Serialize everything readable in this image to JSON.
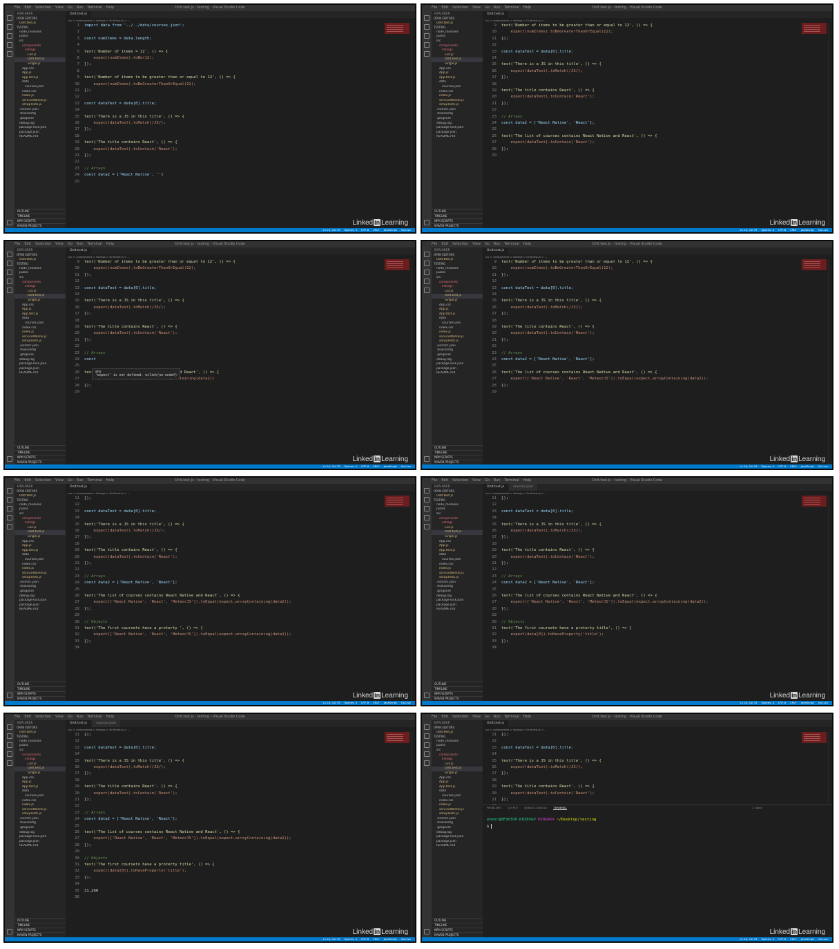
{
  "window": {
    "menu": [
      "File",
      "Edit",
      "Selection",
      "View",
      "Go",
      "Run",
      "Terminal",
      "Help"
    ],
    "title": "OnIt.test.js - testing - Visual Studio Code",
    "watermark_pre": "Linked",
    "watermark_in": "in",
    "watermark_post": "Learning"
  },
  "sidebar": {
    "explorer_label": "EXPLORER",
    "open_editors_label": "OPEN EDITORS",
    "folder_label": "TESTING",
    "files": [
      {
        "name": "node_modules",
        "depth": 1
      },
      {
        "name": "public",
        "depth": 1
      },
      {
        "name": "src",
        "depth": 1
      },
      {
        "name": "components",
        "depth": 2
      },
      {
        "name": "listings",
        "depth": 3
      },
      {
        "name": "List.js",
        "depth": 4
      },
      {
        "name": "OnIt.test.js",
        "depth": 4,
        "selected": true
      },
      {
        "name": "Single.js",
        "depth": 4
      },
      {
        "name": "App.css",
        "depth": 2
      },
      {
        "name": "App.js",
        "depth": 2
      },
      {
        "name": "App.test.js",
        "depth": 2
      },
      {
        "name": "data",
        "depth": 2
      },
      {
        "name": "courses.json",
        "depth": 3
      },
      {
        "name": "index.css",
        "depth": 2
      },
      {
        "name": "index.js",
        "depth": 2
      },
      {
        "name": "serviceWorker.js",
        "depth": 2
      },
      {
        "name": "setupTests.js",
        "depth": 2
      },
      {
        "name": ".eslintrc.json",
        "depth": 1
      },
      {
        "name": ".flowconfig",
        "depth": 1
      },
      {
        "name": ".gitignore",
        "depth": 1
      },
      {
        "name": "debug.log",
        "depth": 1
      },
      {
        "name": "package-lock.json",
        "depth": 1
      },
      {
        "name": "package.json",
        "depth": 1
      },
      {
        "name": "README.md",
        "depth": 1
      }
    ],
    "footer": [
      "OUTLINE",
      "TIMELINE",
      "NPM SCRIPTS",
      "MAVEN PROJECTS"
    ]
  },
  "editor": {
    "tab_main": "OnIt.test.js",
    "tab_json": "courses.json",
    "breadcrumb": "src > components > listings > OnIt.test.js > ..."
  },
  "status": {
    "items": [
      "Ln 24, Col 33",
      "Spaces: 4",
      "UTF-8",
      "CRLF",
      "JavaScript",
      "Go Live"
    ]
  },
  "panels": [
    {
      "lines": [
        {
          "n": 1,
          "t": "import data from '../../data/courses.json';"
        },
        {
          "n": 2,
          "t": ""
        },
        {
          "n": 3,
          "t": "const numItems = data.length;"
        },
        {
          "n": 4,
          "t": ""
        },
        {
          "n": 5,
          "t": "test('Number of items = 12', () => {"
        },
        {
          "n": 6,
          "t": "    expect(numItems).toBe(12);"
        },
        {
          "n": 7,
          "t": "});"
        },
        {
          "n": 8,
          "t": ""
        },
        {
          "n": 9,
          "t": "test('Number of items to be greater than or equal to 12', () => {"
        },
        {
          "n": 10,
          "t": "    expect(numItems).toBeGreaterThanOrEqual(12);"
        },
        {
          "n": 11,
          "t": "});"
        },
        {
          "n": 12,
          "t": ""
        },
        {
          "n": 13,
          "t": "const dataTest = data[0].title;"
        },
        {
          "n": 14,
          "t": ""
        },
        {
          "n": 15,
          "t": "test('There is a JS in this title', () => {"
        },
        {
          "n": 16,
          "t": "    expect(dataTest).toMatch(/JS/);"
        },
        {
          "n": 17,
          "t": "});"
        },
        {
          "n": 18,
          "t": ""
        },
        {
          "n": 19,
          "t": "test('The title contains React', () => {"
        },
        {
          "n": 20,
          "t": "    expect(dataTest).toContain('React');"
        },
        {
          "n": 21,
          "t": "});"
        },
        {
          "n": 22,
          "t": ""
        },
        {
          "n": 23,
          "t": "// Arrays"
        },
        {
          "n": 24,
          "t": "const data2 = ['React Native', '']"
        },
        {
          "n": 25,
          "t": ""
        }
      ]
    },
    {
      "lines": [
        {
          "n": 9,
          "t": "test('Number of items to be greater than or equal to 12', () => {"
        },
        {
          "n": 10,
          "t": "    expect(numItems).toBeGreaterThanOrEqual(12);"
        },
        {
          "n": 11,
          "t": "});"
        },
        {
          "n": 12,
          "t": ""
        },
        {
          "n": 13,
          "t": "const dataTest = data[0].title;"
        },
        {
          "n": 14,
          "t": ""
        },
        {
          "n": 15,
          "t": "test('There is a JS in this title', () => {"
        },
        {
          "n": 16,
          "t": "    expect(dataTest).toMatch(/JS/);"
        },
        {
          "n": 17,
          "t": "});"
        },
        {
          "n": 18,
          "t": ""
        },
        {
          "n": 19,
          "t": "test('The title contains React', () => {"
        },
        {
          "n": 20,
          "t": "    expect(dataTest).toContain('React');"
        },
        {
          "n": 21,
          "t": "});"
        },
        {
          "n": 22,
          "t": ""
        },
        {
          "n": 23,
          "t": "// Arrays"
        },
        {
          "n": 24,
          "t": "const data2 = ['React Native', 'React'];"
        },
        {
          "n": 25,
          "t": ""
        },
        {
          "n": 26,
          "t": "test('The list of courses contains React Native and React', () => {"
        },
        {
          "n": 27,
          "t": "    expect(dataTest).toContain('React');"
        },
        {
          "n": 28,
          "t": "});"
        },
        {
          "n": 29,
          "t": ""
        }
      ]
    },
    {
      "tooltip_line1": "any",
      "tooltip_line2": "'expect' is not defined. eslint(no-undef)",
      "lines": [
        {
          "n": 9,
          "t": "test('Number of items to be greater than or equal to 12', () => {"
        },
        {
          "n": 10,
          "t": "    expect(numItems).toBeGreaterThanOrEqual(12);"
        },
        {
          "n": 11,
          "t": "});"
        },
        {
          "n": 12,
          "t": ""
        },
        {
          "n": 13,
          "t": "const dataTest = data[0].title;"
        },
        {
          "n": 14,
          "t": ""
        },
        {
          "n": 15,
          "t": "test('There is a JS in this title', () => {"
        },
        {
          "n": 16,
          "t": "    expect(dataTest).toMatch(/JS/);"
        },
        {
          "n": 17,
          "t": "});"
        },
        {
          "n": 18,
          "t": ""
        },
        {
          "n": 19,
          "t": "test('The title contains React', () => {"
        },
        {
          "n": 20,
          "t": "    expect(dataTest).toContain('React');"
        },
        {
          "n": 21,
          "t": "});"
        },
        {
          "n": 22,
          "t": ""
        },
        {
          "n": 23,
          "t": "// Arrays"
        },
        {
          "n": 24,
          "t": "const"
        },
        {
          "n": 25,
          "t": ""
        },
        {
          "n": 26,
          "t": "test                                 e and React', () => {"
        },
        {
          "n": 27,
          "t": "    expect(data2).toEqual(expect.arrayContaining(data2))"
        },
        {
          "n": 28,
          "t": "});"
        },
        {
          "n": 29,
          "t": ""
        }
      ]
    },
    {
      "lines": [
        {
          "n": 9,
          "t": "test('Number of items to be greater than or equal to 12', () => {"
        },
        {
          "n": 10,
          "t": "    expect(numItems).toBeGreaterThanOrEqual(12);"
        },
        {
          "n": 11,
          "t": "});"
        },
        {
          "n": 12,
          "t": ""
        },
        {
          "n": 13,
          "t": "const dataTest = data[0].title;"
        },
        {
          "n": 14,
          "t": ""
        },
        {
          "n": 15,
          "t": "test('There is a JS in this title', () => {"
        },
        {
          "n": 16,
          "t": "    expect(dataTest).toMatch(/JS/);"
        },
        {
          "n": 17,
          "t": "});"
        },
        {
          "n": 18,
          "t": ""
        },
        {
          "n": 19,
          "t": "test('The title contains React', () => {"
        },
        {
          "n": 20,
          "t": "    expect(dataTest).toContain('React');"
        },
        {
          "n": 21,
          "t": "});"
        },
        {
          "n": 22,
          "t": ""
        },
        {
          "n": 23,
          "t": "// Arrays"
        },
        {
          "n": 24,
          "t": "const data2 = ['React Native', 'React'];"
        },
        {
          "n": 25,
          "t": ""
        },
        {
          "n": 26,
          "t": "test('The list of courses contains React Native and React', () => {"
        },
        {
          "n": 27,
          "t": "    expect(['React Native', 'React', 'MeteorJS']).toEqual(expect.arrayContaining(data2));"
        },
        {
          "n": 28,
          "t": "});"
        },
        {
          "n": 29,
          "t": ""
        }
      ]
    },
    {
      "lines": [
        {
          "n": 11,
          "t": "});"
        },
        {
          "n": 12,
          "t": ""
        },
        {
          "n": 13,
          "t": "const dataTest = data[0].title;"
        },
        {
          "n": 14,
          "t": ""
        },
        {
          "n": 15,
          "t": "test('There is a JS in this title', () => {"
        },
        {
          "n": 16,
          "t": "    expect(dataTest).toMatch(/JS/);"
        },
        {
          "n": 17,
          "t": "});"
        },
        {
          "n": 18,
          "t": ""
        },
        {
          "n": 19,
          "t": "test('The title contains React', () => {"
        },
        {
          "n": 20,
          "t": "    expect(dataTest).toContain('React');"
        },
        {
          "n": 21,
          "t": "});"
        },
        {
          "n": 22,
          "t": ""
        },
        {
          "n": 23,
          "t": "// Arrays"
        },
        {
          "n": 24,
          "t": "const data2 = ['React Native', 'React'];"
        },
        {
          "n": 25,
          "t": ""
        },
        {
          "n": 26,
          "t": "test('The list of courses contains React Native and React', () => {"
        },
        {
          "n": 27,
          "t": "    expect(['React Native', 'React', 'MeteorJS']).toEqual(expect.arrayContaining(data2));"
        },
        {
          "n": 28,
          "t": "});"
        },
        {
          "n": 29,
          "t": ""
        },
        {
          "n": 30,
          "t": "// Objects"
        },
        {
          "n": 31,
          "t": "test('The first courseto have a proterty ', () => {"
        },
        {
          "n": 32,
          "t": "    expect(['React Native', 'React', 'MeteorJS']).toEqual(expect.arrayContaining(data2));"
        },
        {
          "n": 33,
          "t": "});"
        },
        {
          "n": 34,
          "t": ""
        }
      ]
    },
    {
      "lines": [
        {
          "n": 11,
          "t": "});"
        },
        {
          "n": 12,
          "t": ""
        },
        {
          "n": 13,
          "t": "const dataTest = data[0].title;"
        },
        {
          "n": 14,
          "t": ""
        },
        {
          "n": 15,
          "t": "test('There is a JS in this title', () => {"
        },
        {
          "n": 16,
          "t": "    expect(dataTest).toMatch(/JS/);"
        },
        {
          "n": 17,
          "t": "});"
        },
        {
          "n": 18,
          "t": ""
        },
        {
          "n": 19,
          "t": "test('The title contains React', () => {"
        },
        {
          "n": 20,
          "t": "    expect(dataTest).toContain('React');"
        },
        {
          "n": 21,
          "t": "});"
        },
        {
          "n": 22,
          "t": ""
        },
        {
          "n": 23,
          "t": "// Arrays"
        },
        {
          "n": 24,
          "t": "const data2 = ['React Native', 'React'];"
        },
        {
          "n": 25,
          "t": ""
        },
        {
          "n": 26,
          "t": "test('The list of courses contains React Native and React', () => {"
        },
        {
          "n": 27,
          "t": "    expect(['React Native', 'React', 'MeteorJS']).toEqual(expect.arrayContaining(data2));"
        },
        {
          "n": 28,
          "t": "});"
        },
        {
          "n": 29,
          "t": ""
        },
        {
          "n": 30,
          "t": "// Objects"
        },
        {
          "n": 31,
          "t": "test('The first courseto have a proterty title', () => {"
        },
        {
          "n": 32,
          "t": "    expect(data[0]).toHaveProperty('title');"
        },
        {
          "n": 33,
          "t": "});"
        },
        {
          "n": 34,
          "t": ""
        }
      ]
    },
    {
      "lines": [
        {
          "n": 11,
          "t": "});"
        },
        {
          "n": 12,
          "t": ""
        },
        {
          "n": 13,
          "t": "const dataTest = data[0].title;"
        },
        {
          "n": 14,
          "t": ""
        },
        {
          "n": 15,
          "t": "test('There is a JS in this title', () => {"
        },
        {
          "n": 16,
          "t": "    expect(dataTest).toMatch(/JS/);"
        },
        {
          "n": 17,
          "t": "});"
        },
        {
          "n": 18,
          "t": ""
        },
        {
          "n": 19,
          "t": "test('The title contains React', () => {"
        },
        {
          "n": 20,
          "t": "    expect(dataTest).toContain('React');"
        },
        {
          "n": 21,
          "t": "});"
        },
        {
          "n": 22,
          "t": ""
        },
        {
          "n": 23,
          "t": "// Arrays"
        },
        {
          "n": 24,
          "t": "const data2 = ['React Native', 'React'];"
        },
        {
          "n": 25,
          "t": ""
        },
        {
          "n": 26,
          "t": "test('The list of courses contains React Native and React', () => {"
        },
        {
          "n": 27,
          "t": "    expect(['React Native', 'React', 'MeteorJS']).toEqual(expect.arrayContaining(data2));"
        },
        {
          "n": 28,
          "t": "});"
        },
        {
          "n": 29,
          "t": ""
        },
        {
          "n": 30,
          "t": "// Objects"
        },
        {
          "n": 31,
          "t": "test('The first courseto have a proterty title', () => {"
        },
        {
          "n": 32,
          "t": "    expect(data[0]).toHaveProperty('title');"
        },
        {
          "n": 33,
          "t": "});"
        },
        {
          "n": 34,
          "t": ""
        },
        {
          "n": 35,
          "t": "31,266"
        },
        {
          "n": 36,
          "t": ""
        }
      ]
    },
    {
      "lines": [
        {
          "n": 11,
          "t": "});"
        },
        {
          "n": 12,
          "t": ""
        },
        {
          "n": 13,
          "t": "const dataTest = data[0].title;"
        },
        {
          "n": 14,
          "t": ""
        },
        {
          "n": 15,
          "t": "test('There is a JS in this title', () => {"
        },
        {
          "n": 16,
          "t": "    expect(dataTest).toMatch(/JS/);"
        },
        {
          "n": 17,
          "t": "});"
        },
        {
          "n": 18,
          "t": ""
        },
        {
          "n": 19,
          "t": "test('The title contains React', () => {"
        },
        {
          "n": 20,
          "t": "    expect(dataTest).toContain('React');"
        },
        {
          "n": 21,
          "t": "});"
        },
        {
          "n": 22,
          "t": ""
        }
      ],
      "terminal": {
        "tabs": [
          "PROBLEMS",
          "OUTPUT",
          "DEBUG CONSOLE",
          "TERMINAL"
        ],
        "active_tab": "TERMINAL",
        "shell": "2: bash",
        "user_host": "ehenr@DESKTOP-K830SGP",
        "env": "MINGW64",
        "path": "~/Desktop/testing",
        "prompt": "$"
      }
    }
  ]
}
